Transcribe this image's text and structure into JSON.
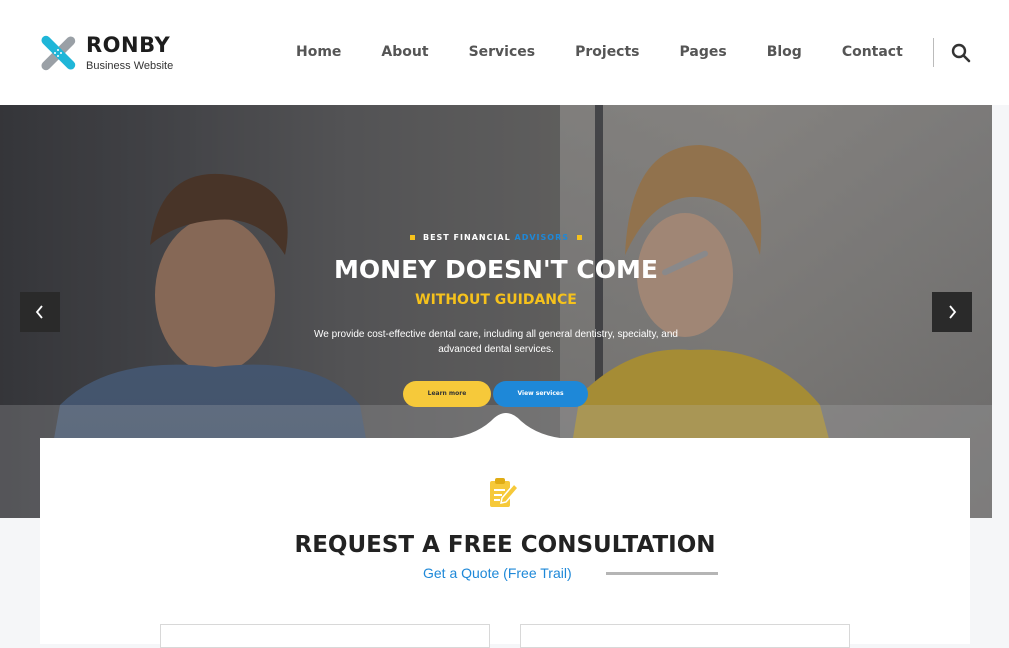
{
  "brand": {
    "name": "RONBY",
    "tagline": "Business Website"
  },
  "nav": {
    "items": [
      "Home",
      "About",
      "Services",
      "Projects",
      "Pages",
      "Blog",
      "Contact"
    ]
  },
  "hero": {
    "eyebrow_main": "BEST FINANCIAL",
    "eyebrow_accent": "ADVISORS",
    "title": "MONEY DOESN'T COME",
    "subtitle": "WITHOUT GUIDANCE",
    "description": "We provide cost-effective dental care, including all general dentistry, specialty, and advanced dental services.",
    "buttons": {
      "learn_more": "Learn more",
      "view_services": "View services"
    }
  },
  "consultation": {
    "title": "REQUEST A FREE CONSULTATION",
    "subtitle": "Get a Quote (Free Trail)"
  },
  "colors": {
    "accent_yellow": "#f6c21c",
    "accent_blue": "#1e88d8",
    "logo_blue": "#1fb6d8",
    "logo_gray": "#9aa0a6"
  },
  "icons": [
    "search-icon",
    "chevron-left-icon",
    "chevron-right-icon",
    "clipboard-edit-icon"
  ]
}
